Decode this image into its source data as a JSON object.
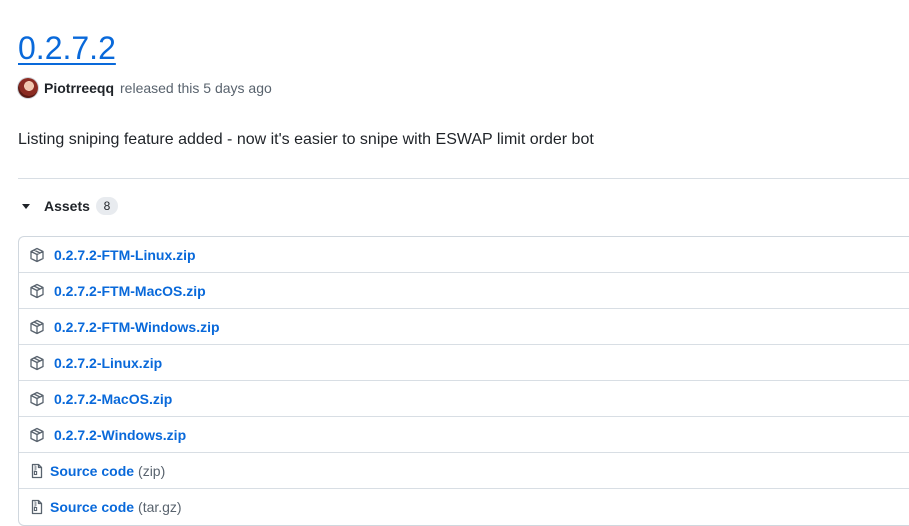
{
  "release": {
    "title": "0.2.7.2",
    "author": "Piotrreeqq",
    "released_text": "released this 5 days ago",
    "description": "Listing sniping feature added - now it's easier to snipe with ESWAP limit order bot"
  },
  "assets": {
    "label": "Assets",
    "count": "8",
    "files": [
      {
        "name": "0.2.7.2-FTM-Linux.zip",
        "icon": "package-icon"
      },
      {
        "name": "0.2.7.2-FTM-MacOS.zip",
        "icon": "package-icon"
      },
      {
        "name": "0.2.7.2-FTM-Windows.zip",
        "icon": "package-icon"
      },
      {
        "name": "0.2.7.2-Linux.zip",
        "icon": "package-icon"
      },
      {
        "name": "0.2.7.2-MacOS.zip",
        "icon": "package-icon"
      },
      {
        "name": "0.2.7.2-Windows.zip",
        "icon": "package-icon"
      }
    ],
    "source": [
      {
        "name": "Source code",
        "suffix": "(zip)",
        "icon": "file-zip-icon"
      },
      {
        "name": "Source code",
        "suffix": "(tar.gz)",
        "icon": "file-zip-icon"
      }
    ]
  }
}
